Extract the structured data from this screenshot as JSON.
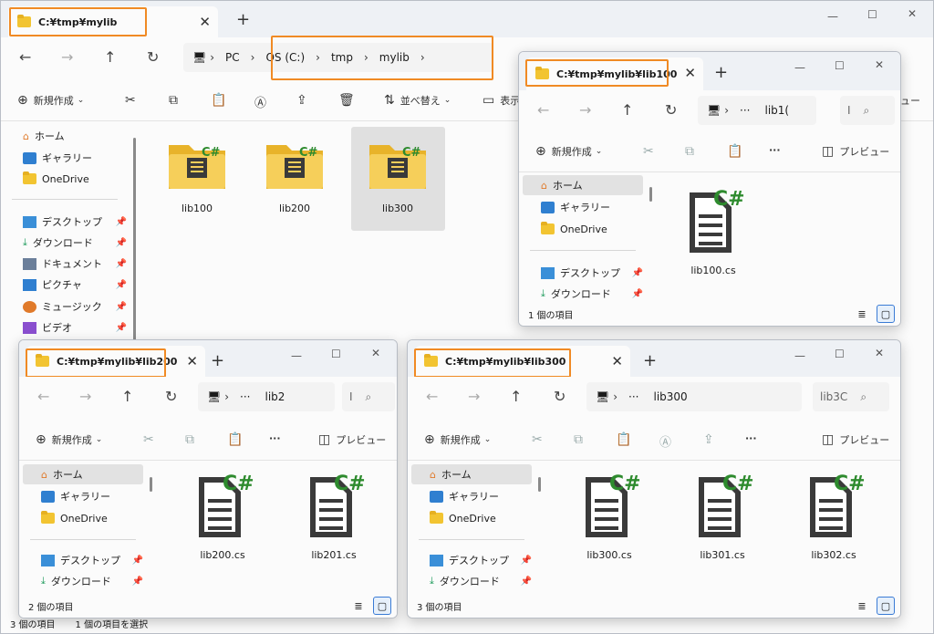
{
  "main": {
    "title": "C:¥tmp¥mylib",
    "breadcrumb": [
      "PC",
      "OS (C:)",
      "tmp",
      "mylib"
    ],
    "commands": {
      "new": "新規作成",
      "sort": "並べ替え",
      "view": "表示",
      "preview_partial": "ュー"
    },
    "sidebar": {
      "home": "ホーム",
      "gallery": "ギャラリー",
      "onedrive": "OneDrive",
      "desktop": "デスクトップ",
      "download": "ダウンロード",
      "documents": "ドキュメント",
      "pictures": "ピクチャ",
      "music": "ミュージック",
      "videos": "ビデオ"
    },
    "folders": [
      "lib100",
      "lib200",
      "lib300"
    ],
    "status_count": "3 個の項目",
    "status_sel": "1 個の項目を選択"
  },
  "w100": {
    "title": "C:¥tmp¥mylib¥lib100",
    "address": "lib1(",
    "search": "I",
    "commands": {
      "new": "新規作成",
      "preview": "プレビュー"
    },
    "sidebar": {
      "home": "ホーム",
      "gallery": "ギャラリー",
      "onedrive": "OneDrive",
      "desktop": "デスクトップ",
      "download": "ダウンロード"
    },
    "files": [
      "lib100.cs"
    ],
    "status": "1 個の項目"
  },
  "w200": {
    "title": "C:¥tmp¥mylib¥lib200",
    "address": "lib2",
    "search": "I",
    "commands": {
      "new": "新規作成",
      "preview": "プレビュー"
    },
    "sidebar": {
      "home": "ホーム",
      "gallery": "ギャラリー",
      "onedrive": "OneDrive",
      "desktop": "デスクトップ",
      "download": "ダウンロード"
    },
    "files": [
      "lib200.cs",
      "lib201.cs"
    ],
    "status": "2 個の項目"
  },
  "w300": {
    "title": "C:¥tmp¥mylib¥lib300",
    "address": "lib300",
    "search": "lib3C",
    "commands": {
      "new": "新規作成",
      "preview": "プレビュー"
    },
    "sidebar": {
      "home": "ホーム",
      "gallery": "ギャラリー",
      "onedrive": "OneDrive",
      "desktop": "デスクトップ",
      "download": "ダウンロード"
    },
    "files": [
      "lib300.cs",
      "lib301.cs",
      "lib302.cs"
    ],
    "status": "3 個の項目"
  },
  "icons": {
    "dots": "···",
    "ellipsis": "···"
  },
  "colors": {
    "highlight": "#f08a24",
    "folder": "#f2c431",
    "csharp": "#2e8b2e"
  }
}
